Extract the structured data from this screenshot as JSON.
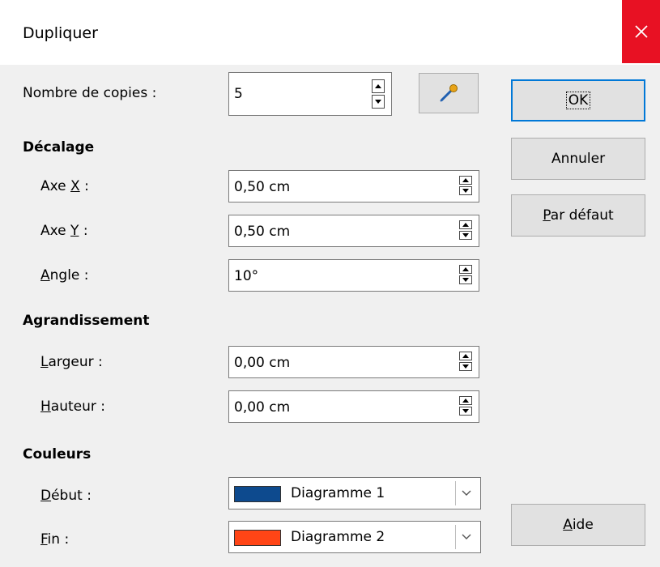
{
  "window": {
    "title": "Dupliquer",
    "close_icon": "close-icon"
  },
  "copies": {
    "label": "Nombre de copies :",
    "value": "5",
    "picker_icon": "pipette-icon"
  },
  "offset": {
    "heading": "Décalage",
    "x": {
      "label_pre": "Axe ",
      "label_accel": "X",
      "label_post": " :",
      "value": "0,50 cm"
    },
    "y": {
      "label_pre": "Axe ",
      "label_accel": "Y",
      "label_post": " :",
      "value": "0,50 cm"
    },
    "angle": {
      "label_accel": "A",
      "label_post": "ngle :",
      "value": "10°"
    }
  },
  "enlargement": {
    "heading": "Agrandissement",
    "width": {
      "label_accel": "L",
      "label_post": "argeur :",
      "value": "0,00 cm"
    },
    "height": {
      "label_accel": "H",
      "label_post": "auteur :",
      "value": "0,00 cm"
    }
  },
  "colors": {
    "heading": "Couleurs",
    "start": {
      "label_accel": "D",
      "label_post": "ébut :",
      "value": "Diagramme 1",
      "swatch": "#0d4a8e"
    },
    "end": {
      "label_accel": "F",
      "label_post": "in :",
      "value": "Diagramme 2",
      "swatch": "#ff4516"
    }
  },
  "buttons": {
    "ok": "OK",
    "cancel": "Annuler",
    "default_accel": "P",
    "default_rest": "ar défaut",
    "help_accel": "A",
    "help_rest": "ide"
  }
}
